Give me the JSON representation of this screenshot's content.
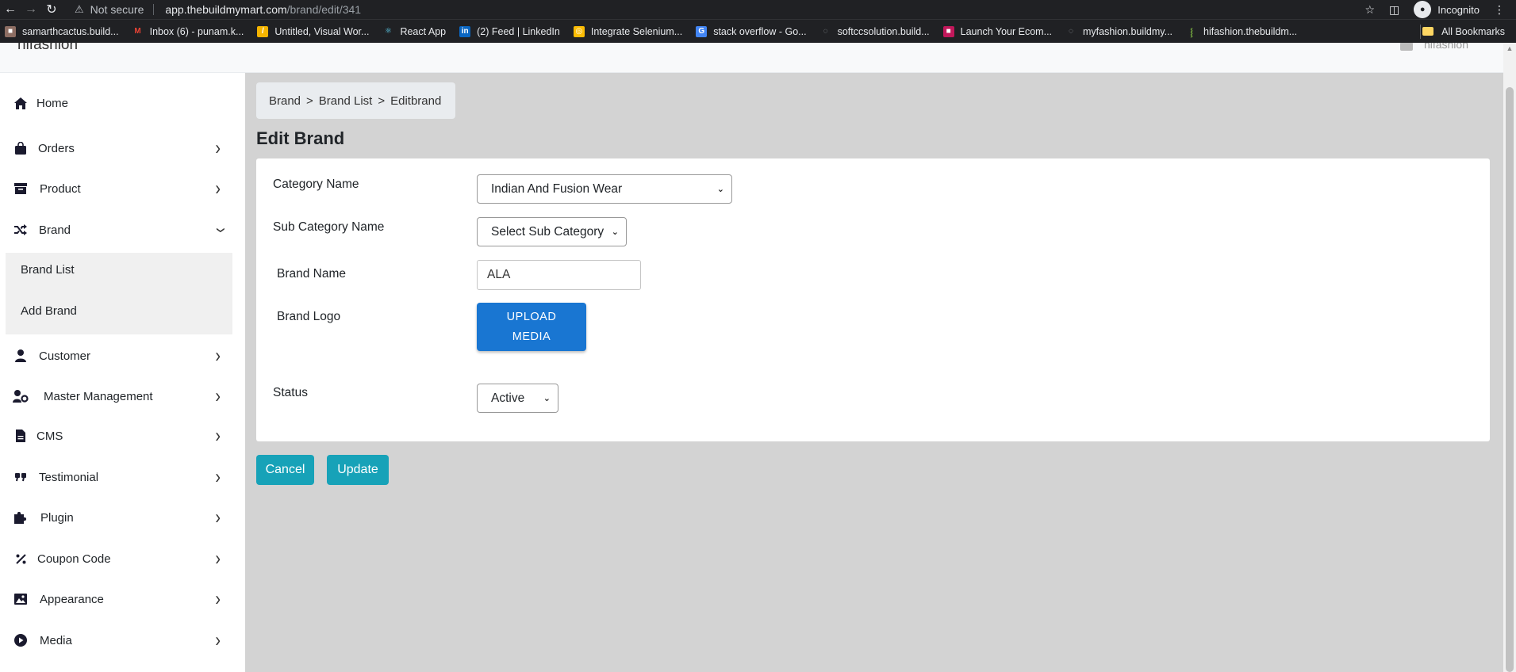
{
  "browser": {
    "security_label": "Not secure",
    "url_host": "app.thebuildmymart.com",
    "url_path": "/brand/edit/341",
    "incognito_label": "Incognito",
    "bookmarks": [
      {
        "label": "samarthcactus.build...",
        "icon": "page-icon",
        "color": "#8d6e63"
      },
      {
        "label": "Inbox (6) - punam.k...",
        "icon": "gmail-icon",
        "color": "#ea4335"
      },
      {
        "label": "Untitled, Visual Wor...",
        "icon": "miro-icon",
        "color": "#f5b400"
      },
      {
        "label": "React App",
        "icon": "react-icon",
        "color": "#61dafb"
      },
      {
        "label": "(2) Feed | LinkedIn",
        "icon": "linkedin-icon",
        "color": "#0a66c2"
      },
      {
        "label": "Integrate Selenium...",
        "icon": "chrome-icon",
        "color": "#fbbc04"
      },
      {
        "label": "stack overflow - Go...",
        "icon": "google-icon",
        "color": "#4285f4"
      },
      {
        "label": "softccsolution.build...",
        "icon": "globe-icon",
        "color": "#9aa0a6"
      },
      {
        "label": "Launch Your Ecom...",
        "icon": "page-icon",
        "color": "#c2185b"
      },
      {
        "label": "myfashion.buildmy...",
        "icon": "globe-icon",
        "color": "#9aa0a6"
      },
      {
        "label": "hifashion.thebuildm...",
        "icon": "leaf-icon",
        "color": "#7cb342"
      }
    ],
    "all_bookmarks": "All Bookmarks"
  },
  "header": {
    "brand": "hifashion",
    "user": "hifashion"
  },
  "sidebar": {
    "items": [
      {
        "label": "Home",
        "icon": "home-icon"
      },
      {
        "label": "Orders",
        "icon": "shopping-bag-icon"
      },
      {
        "label": "Product",
        "icon": "archive-icon"
      },
      {
        "label": "Brand",
        "icon": "shuffle-icon"
      },
      {
        "label": "Customer",
        "icon": "user-icon"
      },
      {
        "label": "Master Management",
        "icon": "user-gear-icon"
      },
      {
        "label": "CMS",
        "icon": "file-icon"
      },
      {
        "label": "Testimonial",
        "icon": "quote-icon"
      },
      {
        "label": "Plugin",
        "icon": "puzzle-icon"
      },
      {
        "label": "Coupon Code",
        "icon": "percent-icon"
      },
      {
        "label": "Appearance",
        "icon": "image-icon"
      },
      {
        "label": "Media",
        "icon": "play-circle-icon"
      }
    ],
    "brand_submenu": [
      "Brand List",
      "Add Brand"
    ]
  },
  "breadcrumb": [
    "Brand",
    "Brand List",
    "Editbrand"
  ],
  "breadcrumb_separator": ">",
  "page_title": "Edit Brand",
  "form": {
    "category_label": "Category Name",
    "category_value": "Indian And Fusion Wear",
    "subcategory_label": "Sub Category Name",
    "subcategory_value": "Select Sub Category",
    "brand_name_label": "Brand Name",
    "brand_name_value": "ALA",
    "brand_logo_label": "Brand Logo",
    "upload_line1": "UPLOAD",
    "upload_line2": "MEDIA",
    "status_label": "Status",
    "status_value": "Active"
  },
  "actions": {
    "cancel": "Cancel",
    "update": "Update"
  }
}
